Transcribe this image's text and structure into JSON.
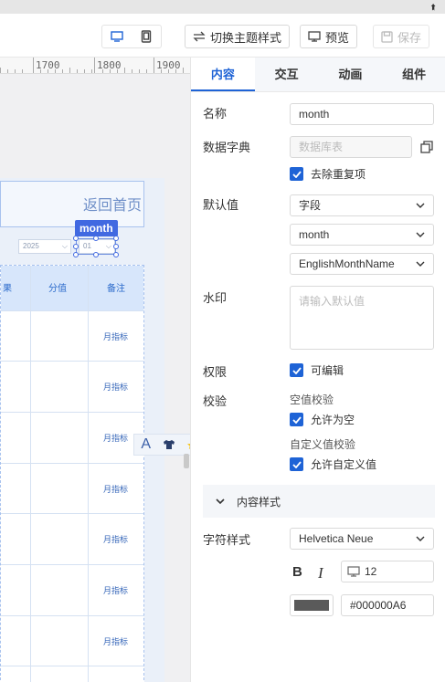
{
  "toolbar": {
    "theme_button": "切换主题样式",
    "preview_button": "预览",
    "save_button": "保存"
  },
  "ruler": {
    "labels": [
      "1700",
      "1800",
      "1900"
    ]
  },
  "canvas": {
    "back_home": "返回首页",
    "component_tag": "month",
    "year_select": "2025",
    "month_select": "01",
    "table_headers": [
      "果",
      "分值",
      "备注"
    ],
    "row_notes": [
      "月指标",
      "月指标",
      "月指标",
      "月指标",
      "月指标",
      "月指标",
      "月指标"
    ]
  },
  "tabs": [
    {
      "label": "内容",
      "active": true
    },
    {
      "label": "交互",
      "active": false
    },
    {
      "label": "动画",
      "active": false
    },
    {
      "label": "组件",
      "active": false
    }
  ],
  "form": {
    "name_label": "名称",
    "name_value": "month",
    "dict_label": "数据字典",
    "dict_placeholder": "数据库表",
    "dedupe_label": "去除重复项",
    "default_label": "默认值",
    "default_type": "字段",
    "default_field": "month",
    "default_display": "EnglishMonthName",
    "watermark_label": "水印",
    "watermark_placeholder": "请输入默认值",
    "permission_label": "权限",
    "editable_label": "可编辑",
    "validation_label": "校验",
    "empty_check_title": "空值校验",
    "allow_empty_label": "允许为空",
    "custom_check_title": "自定义值校验",
    "allow_custom_label": "允许自定义值",
    "section_title": "内容样式",
    "char_style_label": "字符样式",
    "font_value": "Helvetica Neue",
    "bold_label": "B",
    "italic_label": "I",
    "font_size": "12",
    "color_value": "#000000A6"
  },
  "colors": {
    "accent": "#1e63d6",
    "swatch": "#5a5a5a"
  }
}
